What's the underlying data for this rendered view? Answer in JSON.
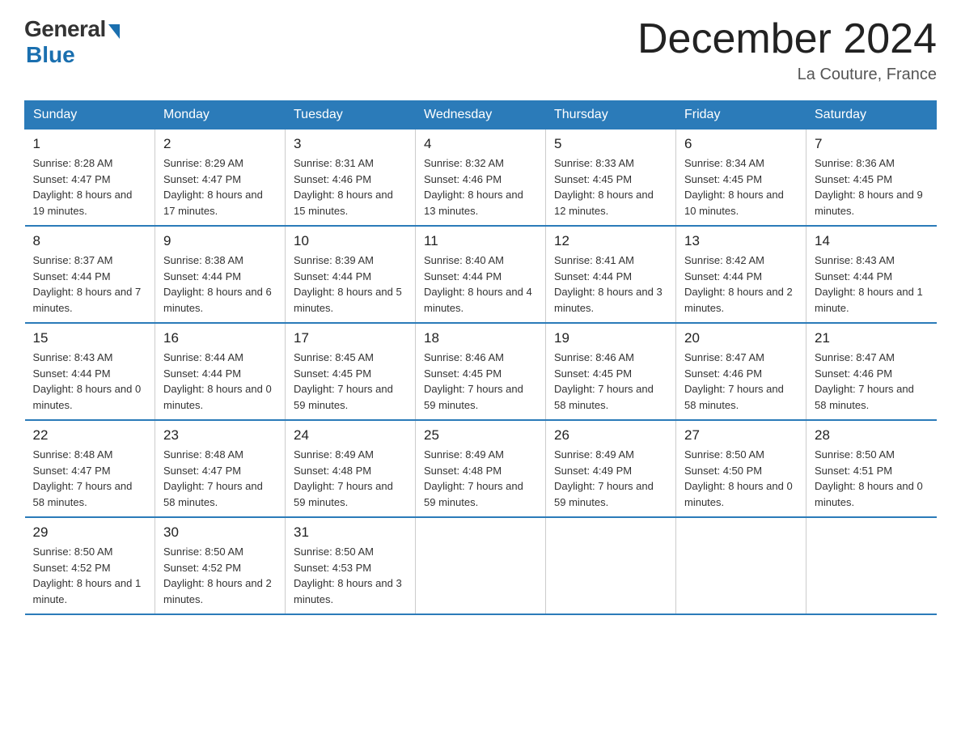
{
  "logo": {
    "general": "General",
    "blue": "Blue"
  },
  "title": "December 2024",
  "location": "La Couture, France",
  "days_of_week": [
    "Sunday",
    "Monday",
    "Tuesday",
    "Wednesday",
    "Thursday",
    "Friday",
    "Saturday"
  ],
  "weeks": [
    [
      {
        "day": "1",
        "sunrise": "8:28 AM",
        "sunset": "4:47 PM",
        "daylight": "8 hours and 19 minutes."
      },
      {
        "day": "2",
        "sunrise": "8:29 AM",
        "sunset": "4:47 PM",
        "daylight": "8 hours and 17 minutes."
      },
      {
        "day": "3",
        "sunrise": "8:31 AM",
        "sunset": "4:46 PM",
        "daylight": "8 hours and 15 minutes."
      },
      {
        "day": "4",
        "sunrise": "8:32 AM",
        "sunset": "4:46 PM",
        "daylight": "8 hours and 13 minutes."
      },
      {
        "day": "5",
        "sunrise": "8:33 AM",
        "sunset": "4:45 PM",
        "daylight": "8 hours and 12 minutes."
      },
      {
        "day": "6",
        "sunrise": "8:34 AM",
        "sunset": "4:45 PM",
        "daylight": "8 hours and 10 minutes."
      },
      {
        "day": "7",
        "sunrise": "8:36 AM",
        "sunset": "4:45 PM",
        "daylight": "8 hours and 9 minutes."
      }
    ],
    [
      {
        "day": "8",
        "sunrise": "8:37 AM",
        "sunset": "4:44 PM",
        "daylight": "8 hours and 7 minutes."
      },
      {
        "day": "9",
        "sunrise": "8:38 AM",
        "sunset": "4:44 PM",
        "daylight": "8 hours and 6 minutes."
      },
      {
        "day": "10",
        "sunrise": "8:39 AM",
        "sunset": "4:44 PM",
        "daylight": "8 hours and 5 minutes."
      },
      {
        "day": "11",
        "sunrise": "8:40 AM",
        "sunset": "4:44 PM",
        "daylight": "8 hours and 4 minutes."
      },
      {
        "day": "12",
        "sunrise": "8:41 AM",
        "sunset": "4:44 PM",
        "daylight": "8 hours and 3 minutes."
      },
      {
        "day": "13",
        "sunrise": "8:42 AM",
        "sunset": "4:44 PM",
        "daylight": "8 hours and 2 minutes."
      },
      {
        "day": "14",
        "sunrise": "8:43 AM",
        "sunset": "4:44 PM",
        "daylight": "8 hours and 1 minute."
      }
    ],
    [
      {
        "day": "15",
        "sunrise": "8:43 AM",
        "sunset": "4:44 PM",
        "daylight": "8 hours and 0 minutes."
      },
      {
        "day": "16",
        "sunrise": "8:44 AM",
        "sunset": "4:44 PM",
        "daylight": "8 hours and 0 minutes."
      },
      {
        "day": "17",
        "sunrise": "8:45 AM",
        "sunset": "4:45 PM",
        "daylight": "7 hours and 59 minutes."
      },
      {
        "day": "18",
        "sunrise": "8:46 AM",
        "sunset": "4:45 PM",
        "daylight": "7 hours and 59 minutes."
      },
      {
        "day": "19",
        "sunrise": "8:46 AM",
        "sunset": "4:45 PM",
        "daylight": "7 hours and 58 minutes."
      },
      {
        "day": "20",
        "sunrise": "8:47 AM",
        "sunset": "4:46 PM",
        "daylight": "7 hours and 58 minutes."
      },
      {
        "day": "21",
        "sunrise": "8:47 AM",
        "sunset": "4:46 PM",
        "daylight": "7 hours and 58 minutes."
      }
    ],
    [
      {
        "day": "22",
        "sunrise": "8:48 AM",
        "sunset": "4:47 PM",
        "daylight": "7 hours and 58 minutes."
      },
      {
        "day": "23",
        "sunrise": "8:48 AM",
        "sunset": "4:47 PM",
        "daylight": "7 hours and 58 minutes."
      },
      {
        "day": "24",
        "sunrise": "8:49 AM",
        "sunset": "4:48 PM",
        "daylight": "7 hours and 59 minutes."
      },
      {
        "day": "25",
        "sunrise": "8:49 AM",
        "sunset": "4:48 PM",
        "daylight": "7 hours and 59 minutes."
      },
      {
        "day": "26",
        "sunrise": "8:49 AM",
        "sunset": "4:49 PM",
        "daylight": "7 hours and 59 minutes."
      },
      {
        "day": "27",
        "sunrise": "8:50 AM",
        "sunset": "4:50 PM",
        "daylight": "8 hours and 0 minutes."
      },
      {
        "day": "28",
        "sunrise": "8:50 AM",
        "sunset": "4:51 PM",
        "daylight": "8 hours and 0 minutes."
      }
    ],
    [
      {
        "day": "29",
        "sunrise": "8:50 AM",
        "sunset": "4:52 PM",
        "daylight": "8 hours and 1 minute."
      },
      {
        "day": "30",
        "sunrise": "8:50 AM",
        "sunset": "4:52 PM",
        "daylight": "8 hours and 2 minutes."
      },
      {
        "day": "31",
        "sunrise": "8:50 AM",
        "sunset": "4:53 PM",
        "daylight": "8 hours and 3 minutes."
      },
      null,
      null,
      null,
      null
    ]
  ],
  "labels": {
    "sunrise": "Sunrise:",
    "sunset": "Sunset:",
    "daylight": "Daylight:"
  }
}
